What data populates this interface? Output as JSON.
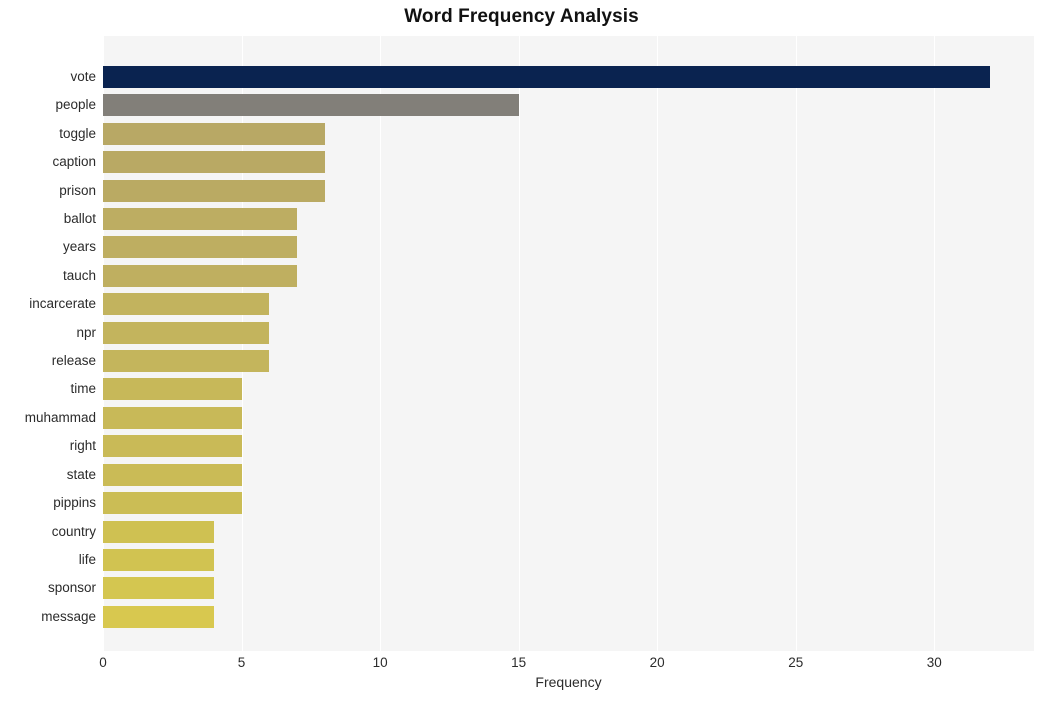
{
  "chart_data": {
    "type": "bar",
    "orientation": "horizontal",
    "title": "Word Frequency Analysis",
    "xlabel": "Frequency",
    "ylabel": "",
    "xlim": [
      0,
      33.6
    ],
    "xticks": [
      0,
      5,
      10,
      15,
      20,
      25,
      30
    ],
    "xtick_labels": [
      "0",
      "5",
      "10",
      "15",
      "20",
      "25",
      "30"
    ],
    "grid": "vertical-white",
    "legend": "none",
    "plot_background": "#f5f5f5",
    "categories": [
      "vote",
      "people",
      "toggle",
      "caption",
      "prison",
      "ballot",
      "years",
      "tauch",
      "incarcerate",
      "npr",
      "release",
      "time",
      "muhammad",
      "right",
      "state",
      "pippins",
      "country",
      "life",
      "sponsor",
      "message"
    ],
    "values": [
      32,
      15,
      8,
      8,
      8,
      7,
      7,
      7,
      6,
      6,
      6,
      5,
      5,
      5,
      5,
      5,
      4,
      4,
      4,
      4
    ],
    "bar_colors": [
      "#0a2350",
      "#827f79",
      "#b8a865",
      "#b9a964",
      "#baaa63",
      "#bdad62",
      "#beae61",
      "#bfaf60",
      "#c2b35e",
      "#c3b45d",
      "#c4b55c",
      "#c7b859",
      "#c8b958",
      "#c9ba57",
      "#cabb56",
      "#cbbd55",
      "#cfc152",
      "#d1c351",
      "#d4c650",
      "#d8c84f"
    ]
  }
}
